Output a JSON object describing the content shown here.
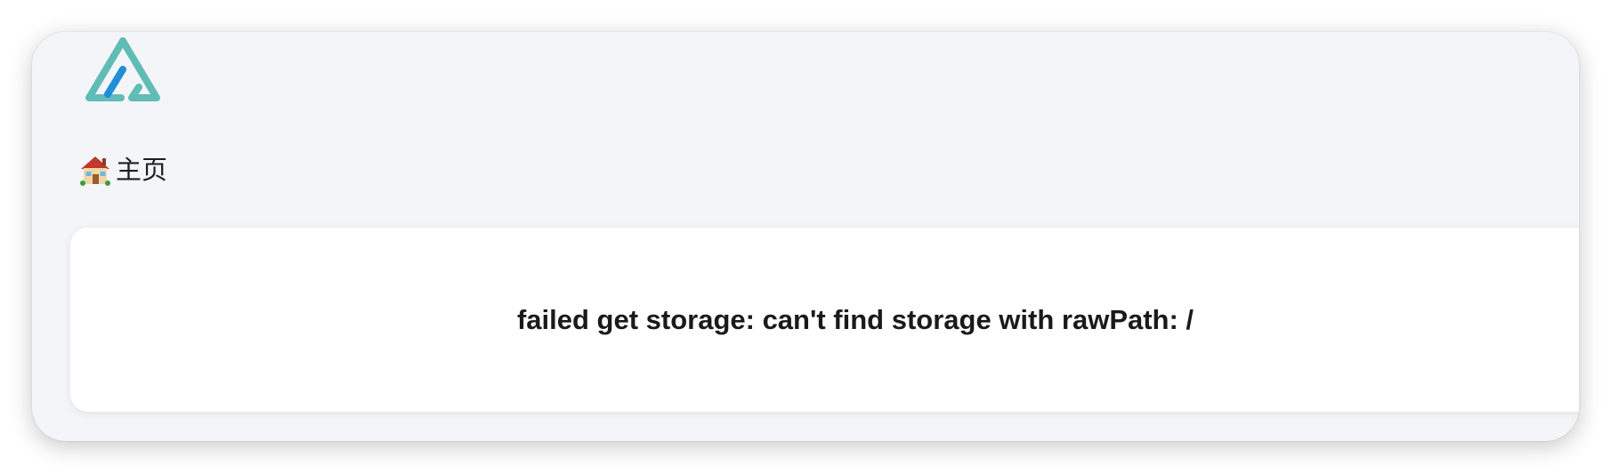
{
  "header": {
    "logo_icon": "alist-logo-icon",
    "brand_colors": {
      "primary": "#5fbdb5",
      "secondary": "#1f8fd6"
    }
  },
  "breadcrumb": {
    "home_icon": "house-emoji-icon",
    "home_label": "主页"
  },
  "main": {
    "error_message": "failed get storage: can't find storage with rawPath: /"
  }
}
